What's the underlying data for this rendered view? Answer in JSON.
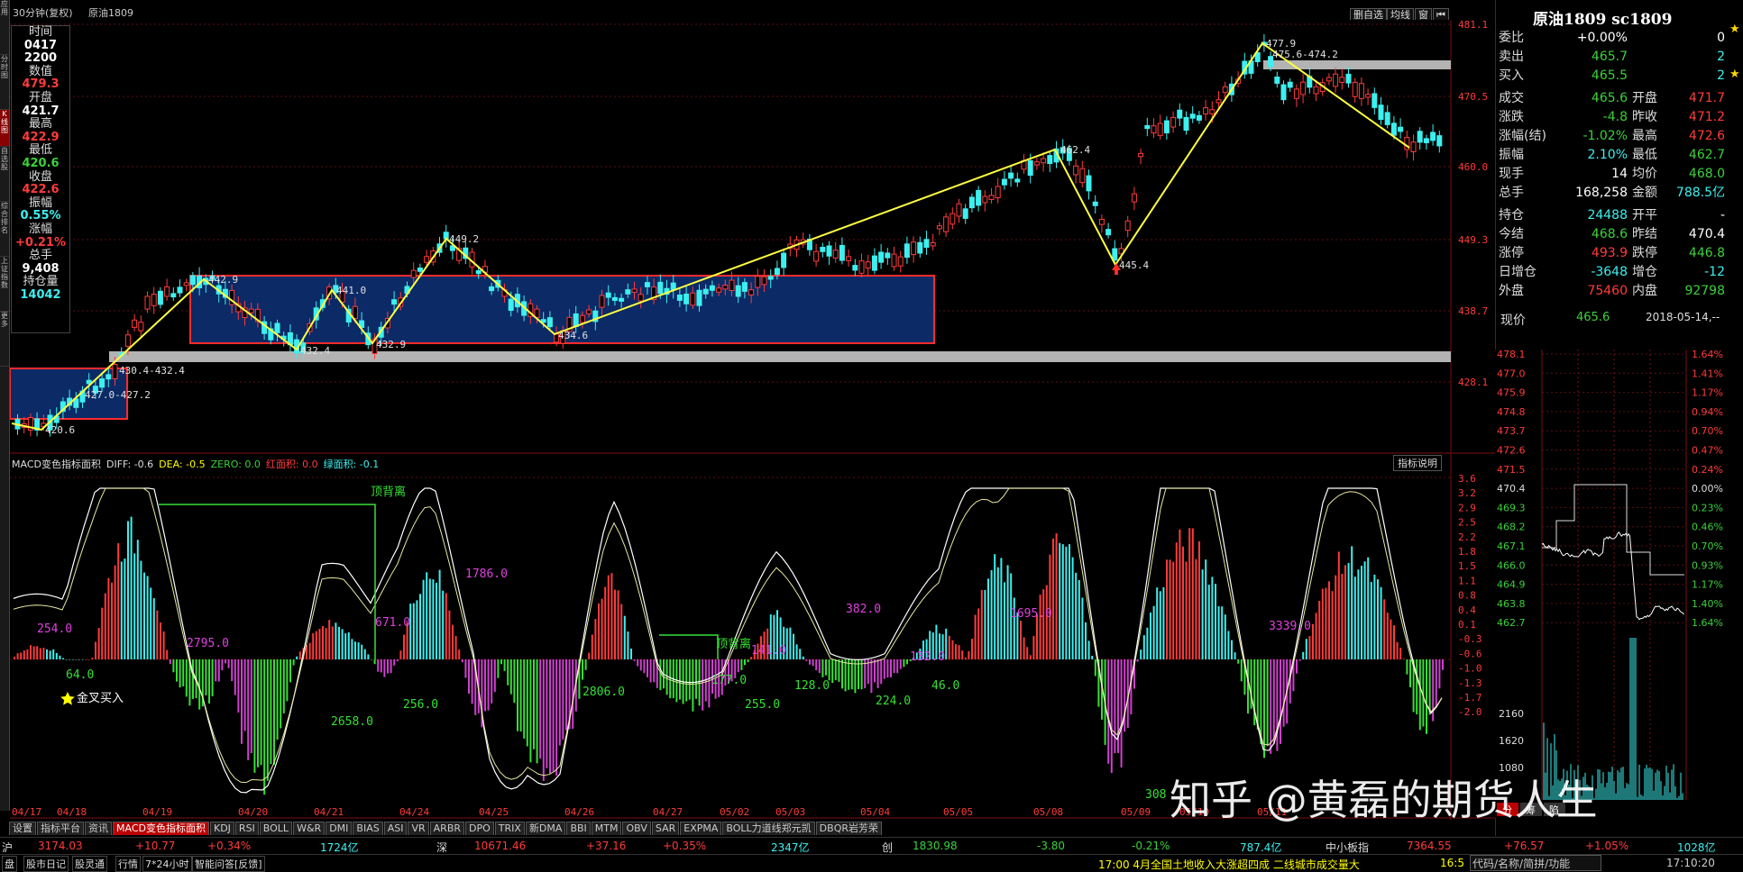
{
  "left_toolbar": [
    "应用",
    "分时图",
    "K线图",
    "自选股",
    "综合排名",
    "上证指数",
    "更多"
  ],
  "top": {
    "period": "30分钟(复权)",
    "symbol": "原油1809",
    "buttons": [
      "删自选",
      "均线",
      "窗",
      "⏮"
    ]
  },
  "info_panel": [
    {
      "label": "时间",
      "value": "0417",
      "value2": "2200",
      "color": "#ffffff"
    },
    {
      "label": "数值",
      "value": "479.3",
      "color": "#ff3b3b"
    },
    {
      "label": "开盘",
      "value": "421.7",
      "color": "#ffffff"
    },
    {
      "label": "最高",
      "value": "422.9",
      "color": "#ff3b3b"
    },
    {
      "label": "最低",
      "value": "420.6",
      "color": "#3bd13b"
    },
    {
      "label": "收盘",
      "value": "422.6",
      "color": "#ff3b3b"
    },
    {
      "label": "振幅",
      "value": "0.55%",
      "color": "#3cf0f0"
    },
    {
      "label": "涨幅",
      "value": "+0.21%",
      "color": "#ff3b3b"
    },
    {
      "label": "总手",
      "value": "9,408",
      "color": "#ffffff"
    },
    {
      "label": "持仓量",
      "value": "14042",
      "color": "#3cf0f0"
    }
  ],
  "price_axis": [
    "481.1",
    "470.5",
    "460.0",
    "449.3",
    "438.7",
    "428.1"
  ],
  "chart_annotations": [
    "477.9",
    "475.6-474.2",
    "462.4",
    "449.2",
    "442.9",
    "441.0",
    "445.4",
    "430.4-432.4",
    "427.0-427.2",
    "432.4",
    "432.9",
    "434.6",
    "420.6"
  ],
  "date_axis": [
    "04/17",
    "04/18",
    "04/19",
    "04/20",
    "04/21",
    "04/24",
    "04/25",
    "04/26",
    "04/27",
    "05/02",
    "05/03",
    "05/04",
    "05/05",
    "05/08",
    "05/09",
    "05/10",
    "05/11"
  ],
  "macd": {
    "header": [
      {
        "text": "MACD变色指标面积",
        "color": "#dddddd"
      },
      {
        "text": "DIFF: -0.6",
        "color": "#dddddd"
      },
      {
        "text": "DEA: -0.5",
        "color": "#ffff00"
      },
      {
        "text": "ZERO: 0.0",
        "color": "#3bd13b"
      },
      {
        "text": "红面积: 0.0",
        "color": "#ff3b3b"
      },
      {
        "text": "绿面积: -0.1",
        "color": "#3cf0f0"
      }
    ],
    "explain_button": "指标说明",
    "axis": [
      "3.6",
      "3.2",
      "2.9",
      "2.5",
      "2.2",
      "1.8",
      "1.5",
      "1.1",
      "0.8",
      "0.4",
      "0.1",
      "-0.3",
      "-0.6",
      "-1.0",
      "-1.3",
      "-1.7",
      "-2.0"
    ],
    "labels": [
      "254.0",
      "64.0",
      "2795.0",
      "2658.0",
      "671.0",
      "256.0",
      "1786.0",
      "2806.0",
      "177.0",
      "141.0",
      "255.0",
      "128.0",
      "382.0",
      "224.0",
      "132.0",
      "46.0",
      "1695.0",
      "3339.0",
      "308"
    ],
    "notes": [
      "顶背离",
      "顶背离",
      "金叉买入"
    ]
  },
  "tabs": [
    "设置",
    "指标平台",
    "资讯",
    "MACD变色指标面积",
    "KDJ",
    "RSI",
    "BOLL",
    "W&R",
    "DMI",
    "BIAS",
    "ASI",
    "VR",
    "ARBR",
    "DPO",
    "TRIX",
    "新DMA",
    "BBI",
    "MTM",
    "OBV",
    "SAR",
    "EXPMA",
    "BOLL力道线郑元凯",
    "DBQR岩芳荣"
  ],
  "status1": [
    {
      "text": "沪",
      "color": "#dddddd"
    },
    {
      "text": "3174.03",
      "color": "#ff3b3b"
    },
    {
      "text": "+10.77",
      "color": "#ff3b3b"
    },
    {
      "text": "+0.34%",
      "color": "#ff3b3b"
    },
    {
      "text": "1724亿",
      "color": "#3cf0f0"
    },
    {
      "text": "深",
      "color": "#dddddd"
    },
    {
      "text": "10671.46",
      "color": "#ff3b3b"
    },
    {
      "text": "+37.16",
      "color": "#ff3b3b"
    },
    {
      "text": "+0.35%",
      "color": "#ff3b3b"
    },
    {
      "text": "2347亿",
      "color": "#3cf0f0"
    },
    {
      "text": "创",
      "color": "#dddddd"
    },
    {
      "text": "1830.98",
      "color": "#3bd13b"
    },
    {
      "text": "-3.80",
      "color": "#3bd13b"
    },
    {
      "text": "-0.21%",
      "color": "#3bd13b"
    },
    {
      "text": "787.4亿",
      "color": "#3cf0f0"
    },
    {
      "text": "中小板指",
      "color": "#dddddd"
    },
    {
      "text": "7364.55",
      "color": "#ff3b3b"
    },
    {
      "text": "+76.57",
      "color": "#ff3b3b"
    },
    {
      "text": "+1.05%",
      "color": "#ff3b3b"
    },
    {
      "text": "1028亿",
      "color": "#3cf0f0"
    }
  ],
  "status2": {
    "left": [
      "盘",
      "股市日记",
      "股灵通",
      "行情",
      "7*24小时",
      "智能问答[反馈]"
    ],
    "news": "17:00 4月全国土地收入大涨超四成 二线城市成交量大",
    "num": "16:5",
    "search": "代码/名称/简拼/功能",
    "clock": "17:10:20"
  },
  "right_panel": {
    "title": "原油1809 sc1809",
    "rows": [
      {
        "l": "委比",
        "v": "+0.00%",
        "vc": "#ffffff",
        "l2": "",
        "v2": "0",
        "v2c": "#ffffff"
      },
      {
        "l": "卖出",
        "v": "465.7",
        "vc": "#3bd13b",
        "l2": "",
        "v2": "2",
        "v2c": "#3cf0f0"
      },
      {
        "l": "买入",
        "v": "465.5",
        "vc": "#3bd13b",
        "l2": "",
        "v2": "2",
        "v2c": "#3cf0f0"
      },
      {
        "l": "成交",
        "v": "465.6",
        "vc": "#3bd13b",
        "l2": "开盘",
        "v2": "471.7",
        "v2c": "#ff3b3b"
      },
      {
        "l": "涨跌",
        "v": "-4.8",
        "vc": "#3bd13b",
        "l2": "昨收",
        "v2": "471.2",
        "v2c": "#ff3b3b"
      },
      {
        "l": "涨幅(结)",
        "v": "-1.02%",
        "vc": "#3bd13b",
        "l2": "最高",
        "v2": "472.6",
        "v2c": "#ff3b3b"
      },
      {
        "l": "振幅",
        "v": "2.10%",
        "vc": "#3cf0f0",
        "l2": "最低",
        "v2": "462.7",
        "v2c": "#3bd13b"
      },
      {
        "l": "现手",
        "v": "14",
        "vc": "#ffffff",
        "l2": "均价",
        "v2": "468.0",
        "v2c": "#3bd13b"
      },
      {
        "l": "总手",
        "v": "168,258",
        "vc": "#ffffff",
        "l2": "金额",
        "v2": "788.5亿",
        "v2c": "#3cf0f0"
      },
      {
        "l": "持仓",
        "v": "24488",
        "vc": "#3cf0f0",
        "l2": "开平",
        "v2": "-",
        "v2c": "#ffffff"
      },
      {
        "l": "今结",
        "v": "468.6",
        "vc": "#3bd13b",
        "l2": "昨结",
        "v2": "470.4",
        "v2c": "#ffffff"
      },
      {
        "l": "涨停",
        "v": "493.9",
        "vc": "#ff3b3b",
        "l2": "跌停",
        "v2": "446.8",
        "v2c": "#3bd13b"
      },
      {
        "l": "日增仓",
        "v": "-3648",
        "vc": "#3cf0f0",
        "l2": "增仓",
        "v2": "-12",
        "v2c": "#3cf0f0"
      },
      {
        "l": "外盘",
        "v": "75460",
        "vc": "#ff3b3b",
        "l2": "内盘",
        "v2": "92798",
        "v2c": "#3bd13b"
      }
    ],
    "price_label": "现价",
    "price": "465.6",
    "date": "2018-05-14,--",
    "minute_axis": [
      "478.1",
      "477.0",
      "475.9",
      "474.8",
      "473.7",
      "472.6",
      "471.5",
      "470.4",
      "469.3",
      "468.2",
      "467.1",
      "466.0",
      "464.9",
      "463.8",
      "462.7"
    ],
    "pct_axis": [
      "1.64%",
      "1.41%",
      "1.17%",
      "0.94%",
      "0.70%",
      "0.47%",
      "0.24%",
      "0.00%",
      "0.23%",
      "0.46%",
      "0.70%",
      "0.93%",
      "1.17%",
      "1.40%",
      "1.64%"
    ],
    "vol_axis": [
      "2160",
      "1620",
      "1080"
    ],
    "bottom_tabs": [
      "分",
      "筹",
      "陷"
    ]
  },
  "watermark": "知乎 @黄磊的期货人生"
}
